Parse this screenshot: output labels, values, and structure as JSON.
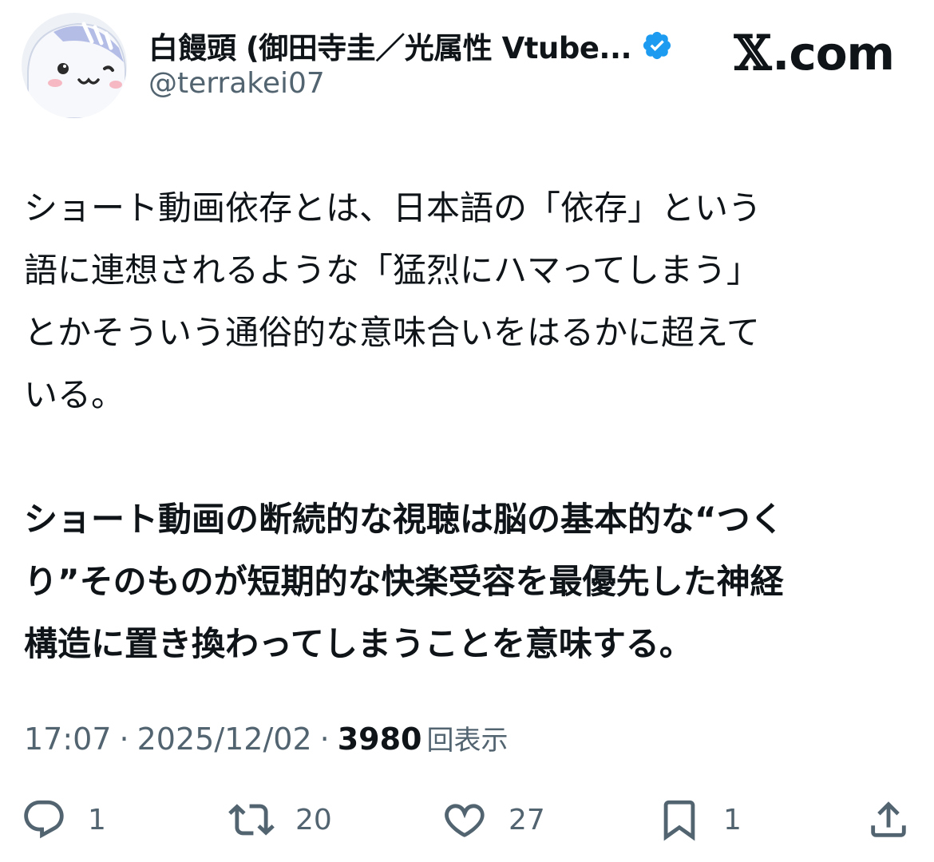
{
  "author": {
    "display_name": "白饅頭 (御田寺圭／光属性 Vtube...",
    "handle": "@terrakei07",
    "verified": true,
    "avatar_icon": "manju-mascot-avatar"
  },
  "brand": {
    "label": ".com",
    "logo": "x-logo"
  },
  "post": {
    "paragraph1_lines": [
      "ショート動画依存とは、日本語の「依存」という",
      "語に連想されるような「猛烈にハマってしまう」",
      "とかそういう通俗的な意味合いをはるかに超えて",
      "いる。"
    ],
    "paragraph2_lines": [
      "ショート動画の断続的な視聴は脳の基本的な“つく",
      "り”そのものが短期的な快楽受容を最優先した神経",
      "構造に置き換わってしまうことを意味する。"
    ]
  },
  "meta": {
    "time": "17:07",
    "separator": "·",
    "date": "2025/12/02",
    "views_count": "3980",
    "views_label": "回表示"
  },
  "actions": {
    "reply_count": "1",
    "retweet_count": "20",
    "like_count": "27",
    "bookmark_count": "1"
  },
  "colors": {
    "text": "#0f1419",
    "secondary": "#536471",
    "verified": "#1d9bf0",
    "avatar_bg": "#e8edf7",
    "avatar_hat": "#aeb8e0"
  }
}
